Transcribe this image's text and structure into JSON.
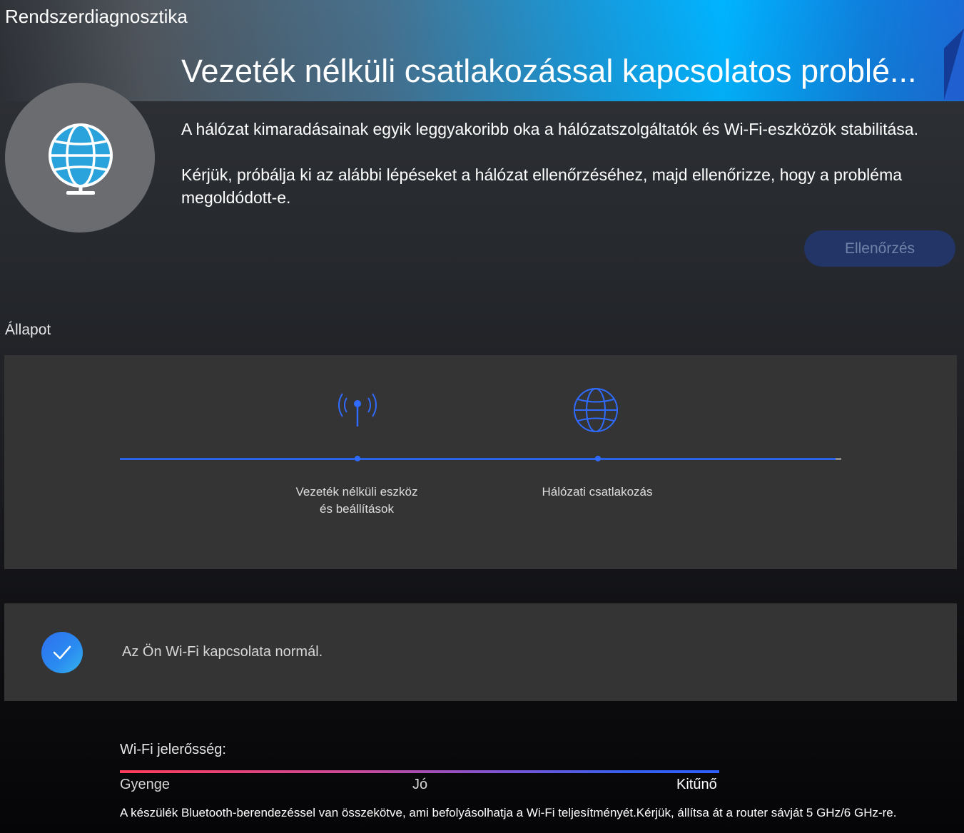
{
  "app": {
    "title": "Rendszerdiagnosztika"
  },
  "header": {
    "heading": "Vezeték nélküli csatlakozással kapcsolatos problé...",
    "hero_icon": "globe-icon"
  },
  "description": {
    "paragraph_1": "A hálózat kimaradásainak egyik leggyakoribb oka a hálózatszolgáltatók és Wi-Fi-eszközök stabilitása.",
    "paragraph_2": " Kérjük, próbálja ki az alábbi lépéseket a hálózat ellenőrzéséhez, majd ellenőrizze, hogy a probléma megoldódott-e."
  },
  "actions": {
    "check_label": "Ellenőrzés"
  },
  "status": {
    "section_label": "Állapot",
    "steps": [
      {
        "label": "Vezeték nélküli eszköz\nés beállítások",
        "icon": "antenna-icon"
      },
      {
        "label": "Hálózati csatlakozás",
        "icon": "globe-icon"
      }
    ]
  },
  "result": {
    "icon": "checkmark-icon",
    "message": "Az Ön Wi-Fi kapcsolata normál."
  },
  "signal": {
    "label": "Wi-Fi jelerősség:",
    "scale": {
      "weak": "Gyenge",
      "good": "Jó",
      "excellent": "Kitűnő"
    },
    "level": "excellent"
  },
  "footer": {
    "note": "A készülék Bluetooth-berendezéssel van összekötve, ami befolyásolhatja a Wi-Fi teljesítményét.Kérjük, állítsa át a router sávját 5 GHz/6 GHz-re."
  },
  "colors": {
    "accent": "#2f6bff",
    "button_bg": "#223566",
    "panel_bg": "#343434"
  }
}
